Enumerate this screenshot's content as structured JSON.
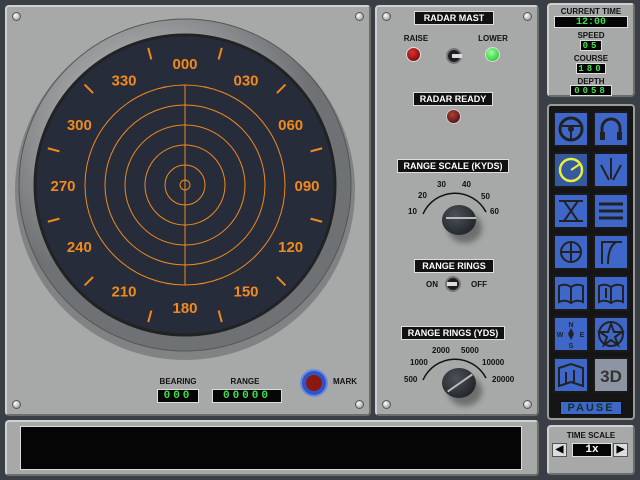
{
  "radar": {
    "bearings": [
      "000",
      "030",
      "060",
      "090",
      "120",
      "150",
      "180",
      "210",
      "240",
      "270",
      "300",
      "330"
    ],
    "bearing_label": "BEARING",
    "bearing_value": "000",
    "range_label": "RANGE",
    "range_value": "00000",
    "mark_label": "MARK"
  },
  "mast": {
    "title": "RADAR MAST",
    "raise": "RAISE",
    "lower": "LOWER",
    "ready": "RADAR READY"
  },
  "range_scale": {
    "title": "RANGE SCALE (KYDS)",
    "ticks": {
      "t10": "10",
      "t20": "20",
      "t30": "30",
      "t40": "40",
      "t50": "50",
      "t60": "60"
    }
  },
  "range_rings": {
    "title": "RANGE RINGS",
    "on": "ON",
    "off": "OFF"
  },
  "range_rings_yds": {
    "title": "RANGE RINGS (YDS)",
    "ticks": {
      "t500": "500",
      "t1000": "1000",
      "t2000": "2000",
      "t5000": "5000",
      "t10000": "10000",
      "t20000": "20000"
    }
  },
  "status": {
    "time_label": "CURRENT TIME",
    "time": "12:00",
    "speed_label": "SPEED",
    "speed": "05",
    "course_label": "COURSE",
    "course": "180",
    "depth_label": "DEPTH",
    "depth": "0058"
  },
  "stations": {
    "pause": "PAUSE",
    "threed": "3D",
    "compass_n": "N",
    "compass_s": "S",
    "compass_e": "E",
    "compass_w": "W"
  },
  "time_scale": {
    "label": "TIME SCALE",
    "value": "1x"
  },
  "colors": {
    "scope": "#272c3a",
    "orange": "#f08a1e",
    "button_blue": "#3f67c9",
    "lcd": "#3fe04a"
  }
}
